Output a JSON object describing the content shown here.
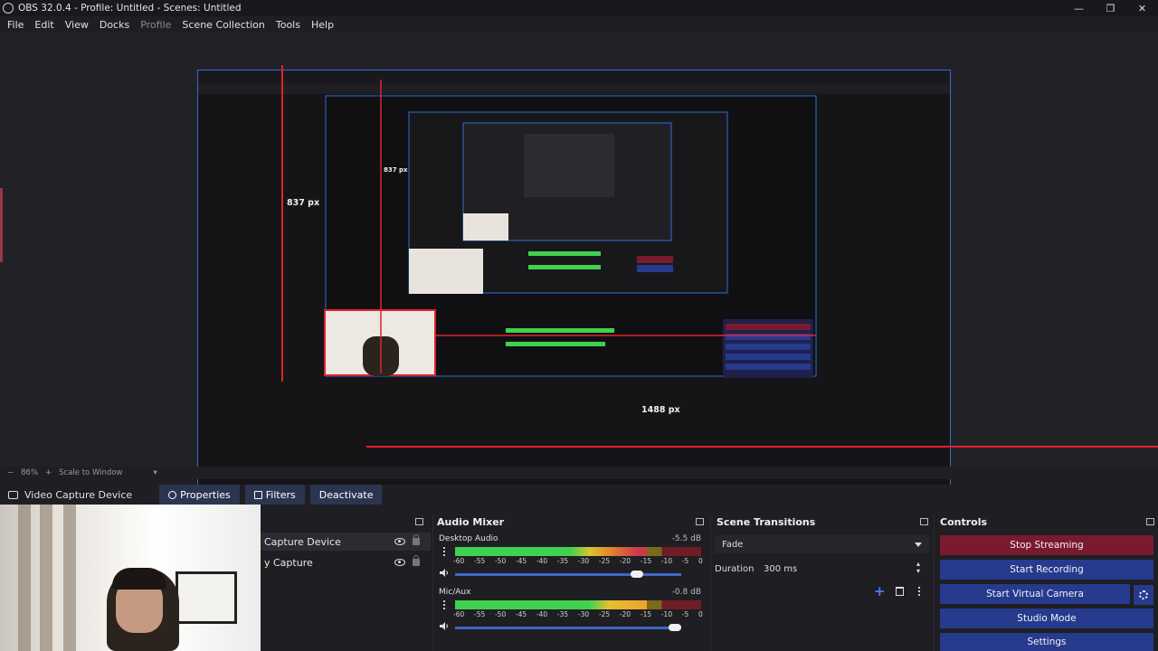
{
  "window": {
    "title": "OBS 32.0.4 - Profile: Untitled - Scenes: Untitled",
    "minimize": "—",
    "maximize": "❐",
    "close": "✕"
  },
  "menu": [
    "File",
    "Edit",
    "View",
    "Docks",
    "Profile",
    "Scene Collection",
    "Tools",
    "Help"
  ],
  "preview": {
    "height_label": "837 px",
    "width_label": "1488 px",
    "nested_height_label": "837 px"
  },
  "zoom": {
    "minus": "−",
    "value": "86%",
    "plus": "+",
    "mode": "Scale to Window"
  },
  "source_toolbar": {
    "source_name": "Video Capture Device",
    "properties": "Properties",
    "filters": "Filters",
    "deactivate": "Deactivate"
  },
  "sources": {
    "items": [
      {
        "label": "Capture Device",
        "selected": true
      },
      {
        "label": "y Capture",
        "selected": false
      }
    ]
  },
  "audio_mixer": {
    "title": "Audio Mixer",
    "scale": [
      "-60",
      "-55",
      "-50",
      "-45",
      "-40",
      "-35",
      "-30",
      "-25",
      "-20",
      "-15",
      "-10",
      "-5",
      "0"
    ],
    "channels": [
      {
        "name": "Desktop Audio",
        "db": "-5.5 dB",
        "level": 0.78,
        "volume": 0.82
      },
      {
        "name": "Mic/Aux",
        "db": "-0.8 dB",
        "level": 0.78,
        "volume": 1.0
      }
    ]
  },
  "scene_transitions": {
    "title": "Scene Transitions",
    "transition": "Fade",
    "duration_label": "Duration",
    "duration_value": "300 ms"
  },
  "controls": {
    "title": "Controls",
    "stop_streaming": "Stop Streaming",
    "start_recording": "Start Recording",
    "start_virtual_camera": "Start Virtual Camera",
    "studio_mode": "Studio Mode",
    "settings": "Settings"
  },
  "colors": {
    "accent": "#263a8e",
    "streaming": "#7a1a2e",
    "selection": "#e0222e",
    "preview_border": "#2f6bd1"
  }
}
